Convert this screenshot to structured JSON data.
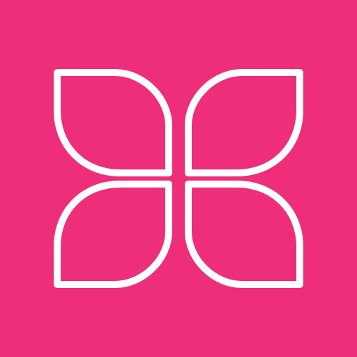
{
  "icon": {
    "name": "four-petal-flower-logo",
    "background_color": "#EE2D7B",
    "stroke_color": "#FFFFFF",
    "petals": [
      "top-left",
      "top-right",
      "bottom-left",
      "bottom-right"
    ]
  }
}
